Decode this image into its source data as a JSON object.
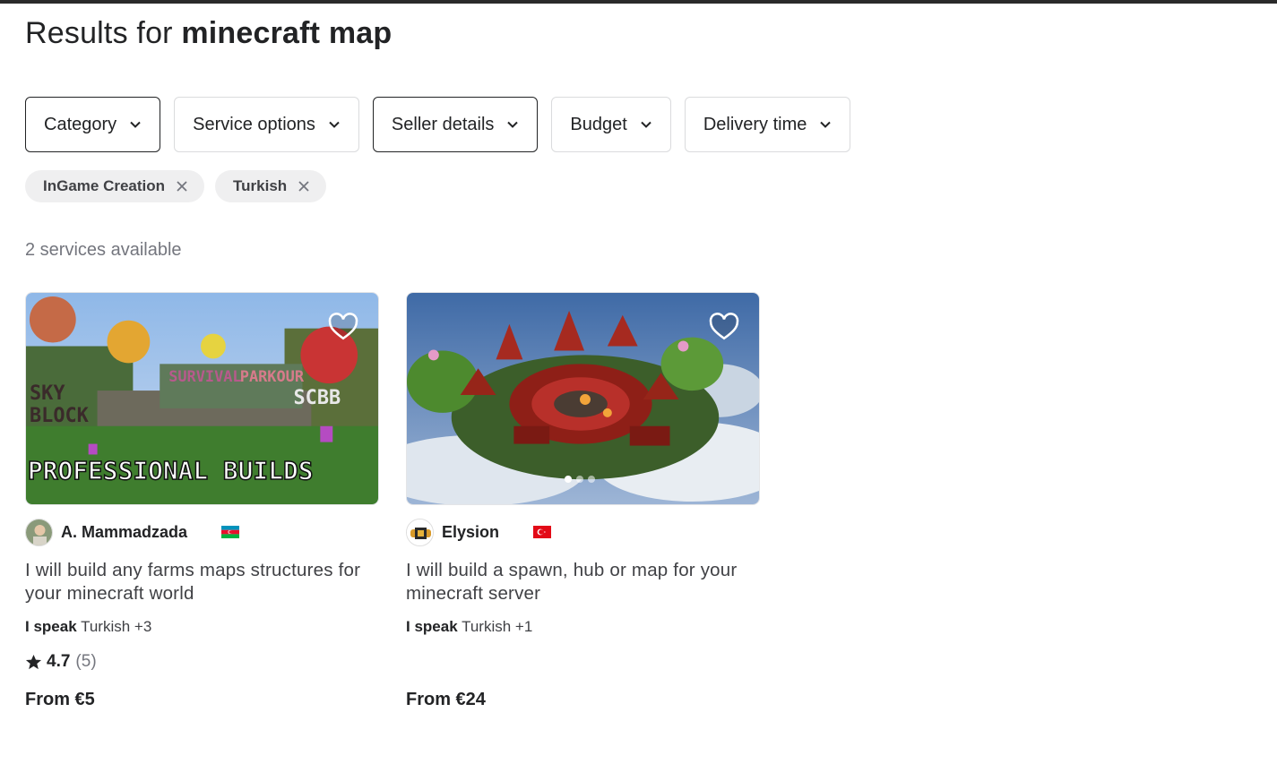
{
  "header": {
    "title_prefix": "Results for",
    "query": "minecraft map"
  },
  "filters": [
    {
      "label": "Category",
      "active": true
    },
    {
      "label": "Service options",
      "active": false
    },
    {
      "label": "Seller details",
      "active": true
    },
    {
      "label": "Budget",
      "active": false
    },
    {
      "label": "Delivery time",
      "active": false
    }
  ],
  "chips": [
    {
      "label": "InGame Creation",
      "icon": "close-icon"
    },
    {
      "label": "Turkish",
      "icon": "close-icon"
    }
  ],
  "results_count": "2 services available",
  "gigs": [
    {
      "image_caption": "PROFESSIONAL BUILDS",
      "seller": "A. Mammadzada",
      "flag": "azerbaijan-flag",
      "title": "I will build any farms maps structures for your minecraft world",
      "speak_label": "I speak",
      "languages": "Turkish +3",
      "rating": "4.7",
      "reviews": "(5)",
      "price": "From €5"
    },
    {
      "seller": "Elysion",
      "flag": "turkey-flag",
      "title": "I will build a spawn, hub or map for your minecraft server",
      "speak_label": "I speak",
      "languages": "Turkish +1",
      "price": "From €24",
      "carousel_count": 3,
      "carousel_active": 1
    }
  ],
  "colors": {
    "text": "#222325",
    "muted": "#74767e",
    "chip_bg": "#efeff0",
    "border": "#dadbdd"
  }
}
